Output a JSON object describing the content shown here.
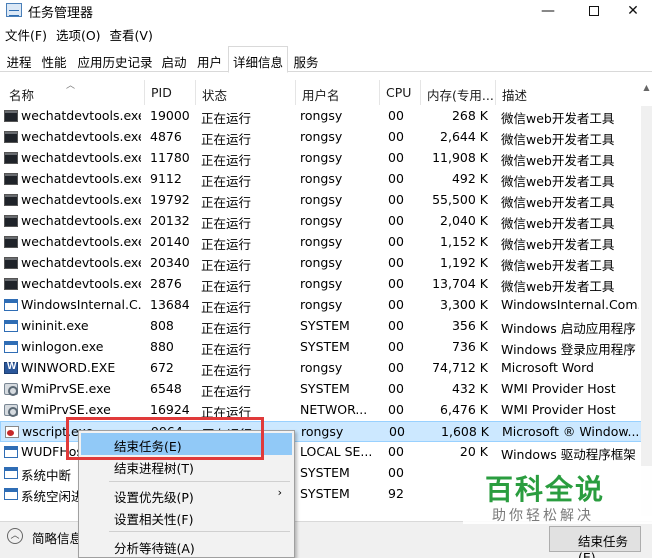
{
  "window": {
    "title": "任务管理器",
    "min_glyph": "—",
    "close_glyph": "✕"
  },
  "menu": [
    "文件(F)",
    "选项(O)",
    "查看(V)"
  ],
  "tabs": [
    "进程",
    "性能",
    "应用历史记录",
    "启动",
    "用户",
    "详细信息",
    "服务"
  ],
  "active_tab": "详细信息",
  "columns": [
    "名称",
    "PID",
    "状态",
    "用户名",
    "CPU",
    "内存(专用...",
    "描述"
  ],
  "rows": [
    {
      "name": "wechatdevtools.exe",
      "pid": "19000",
      "status": "正在运行",
      "user": "rongsy",
      "cpu": "00",
      "mem": "268 K",
      "desc": "微信web开发者工具",
      "icon": "exe-icon"
    },
    {
      "name": "wechatdevtools.exe",
      "pid": "4876",
      "status": "正在运行",
      "user": "rongsy",
      "cpu": "00",
      "mem": "2,644 K",
      "desc": "微信web开发者工具",
      "icon": "exe-icon"
    },
    {
      "name": "wechatdevtools.exe",
      "pid": "11780",
      "status": "正在运行",
      "user": "rongsy",
      "cpu": "00",
      "mem": "11,908 K",
      "desc": "微信web开发者工具",
      "icon": "exe-icon"
    },
    {
      "name": "wechatdevtools.exe",
      "pid": "9112",
      "status": "正在运行",
      "user": "rongsy",
      "cpu": "00",
      "mem": "492 K",
      "desc": "微信web开发者工具",
      "icon": "exe-icon"
    },
    {
      "name": "wechatdevtools.exe",
      "pid": "19792",
      "status": "正在运行",
      "user": "rongsy",
      "cpu": "00",
      "mem": "55,500 K",
      "desc": "微信web开发者工具",
      "icon": "exe-icon"
    },
    {
      "name": "wechatdevtools.exe",
      "pid": "20132",
      "status": "正在运行",
      "user": "rongsy",
      "cpu": "00",
      "mem": "2,040 K",
      "desc": "微信web开发者工具",
      "icon": "exe-icon"
    },
    {
      "name": "wechatdevtools.exe",
      "pid": "20140",
      "status": "正在运行",
      "user": "rongsy",
      "cpu": "00",
      "mem": "1,152 K",
      "desc": "微信web开发者工具",
      "icon": "exe-icon"
    },
    {
      "name": "wechatdevtools.exe",
      "pid": "20340",
      "status": "正在运行",
      "user": "rongsy",
      "cpu": "00",
      "mem": "1,192 K",
      "desc": "微信web开发者工具",
      "icon": "exe-icon"
    },
    {
      "name": "wechatdevtools.exe",
      "pid": "2876",
      "status": "正在运行",
      "user": "rongsy",
      "cpu": "00",
      "mem": "13,704 K",
      "desc": "微信web开发者工具",
      "icon": "exe-icon"
    },
    {
      "name": "WindowsInternal.C...",
      "pid": "13684",
      "status": "正在运行",
      "user": "rongsy",
      "cpu": "00",
      "mem": "3,300 K",
      "desc": "WindowsInternal.Com...",
      "icon": "window-icon"
    },
    {
      "name": "wininit.exe",
      "pid": "808",
      "status": "正在运行",
      "user": "SYSTEM",
      "cpu": "00",
      "mem": "356 K",
      "desc": "Windows 启动应用程序",
      "icon": "window-icon"
    },
    {
      "name": "winlogon.exe",
      "pid": "880",
      "status": "正在运行",
      "user": "SYSTEM",
      "cpu": "00",
      "mem": "736 K",
      "desc": "Windows 登录应用程序",
      "icon": "window-icon"
    },
    {
      "name": "WINWORD.EXE",
      "pid": "672",
      "status": "正在运行",
      "user": "rongsy",
      "cpu": "00",
      "mem": "74,712 K",
      "desc": "Microsoft Word",
      "icon": "word-icon"
    },
    {
      "name": "WmiPrvSE.exe",
      "pid": "6548",
      "status": "正在运行",
      "user": "SYSTEM",
      "cpu": "00",
      "mem": "432 K",
      "desc": "WMI Provider Host",
      "icon": "gear-icon"
    },
    {
      "name": "WmiPrvSE.exe",
      "pid": "16924",
      "status": "正在运行",
      "user": "NETWOR...",
      "cpu": "00",
      "mem": "6,476 K",
      "desc": "WMI Provider Host",
      "icon": "gear-icon"
    },
    {
      "name": "wscript.exe",
      "pid": "9964",
      "status": "正在运行",
      "user": "rongsy",
      "cpu": "00",
      "mem": "1,608 K",
      "desc": "Microsoft ® Window...",
      "icon": "script-icon",
      "selected": true
    },
    {
      "name": "WUDFHost.exe",
      "pid": "",
      "status": "",
      "user": "LOCAL SE...",
      "cpu": "00",
      "mem": "20 K",
      "desc": "Windows 驱动程序框架",
      "icon": "window-icon"
    },
    {
      "name": "系统中断",
      "pid": "",
      "status": "",
      "user": "SYSTEM",
      "cpu": "00",
      "mem": "",
      "desc": "",
      "icon": "window-icon"
    },
    {
      "name": "系统空闲进程",
      "pid": "",
      "status": "",
      "user": "SYSTEM",
      "cpu": "92",
      "mem": "",
      "desc": "",
      "icon": "window-icon"
    }
  ],
  "context_menu": {
    "end_task": "结束任务(E)",
    "end_tree": "结束进程树(T)",
    "set_priority": "设置优先级(P)",
    "set_affinity": "设置相关性(F)",
    "analyze_wait_chain": "分析等待链(A)",
    "submenu_arrow": "›"
  },
  "footer": {
    "fewer_details": "简略信息(D)",
    "end_task_button": "结束任务(E)"
  },
  "watermark": {
    "title": "百科全说",
    "subtitle": "助你轻松解决"
  }
}
